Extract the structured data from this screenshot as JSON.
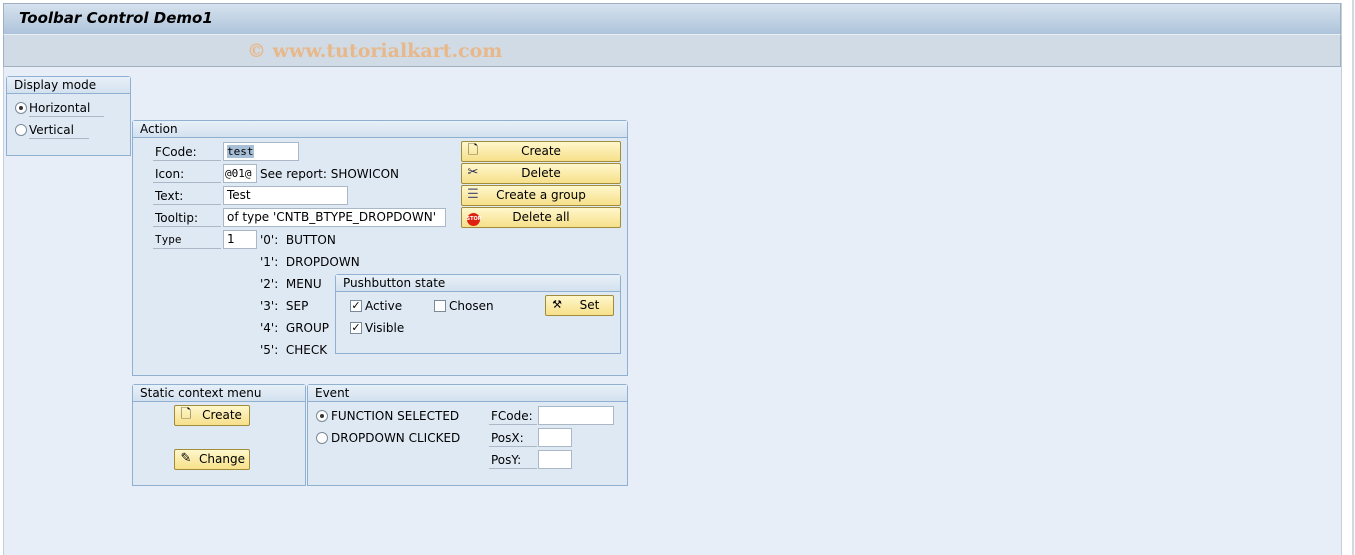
{
  "window": {
    "title": "Toolbar Control Demo1",
    "watermark": "© www.tutorialkart.com"
  },
  "display_mode": {
    "title": "Display mode",
    "options": [
      {
        "label": "Horizontal",
        "selected": true
      },
      {
        "label": "Vertical",
        "selected": false
      }
    ]
  },
  "action": {
    "title": "Action",
    "fcode_label": "FCode:",
    "fcode_value": "test",
    "icon_label": "Icon:",
    "icon_value": "@01@",
    "icon_hint": "See report: SHOWICON",
    "text_label": "Text:",
    "text_value": "Test",
    "tooltip_label": "Tooltip:",
    "tooltip_value": " of type 'CNTB_BTYPE_DROPDOWN'",
    "type_label": "Type",
    "type_value": "1",
    "type_options": [
      "'0':  BUTTON",
      "'1':  DROPDOWN",
      "'2':  MENU",
      "'3':  SEP",
      "'4':  GROUP",
      "'5':  CHECK"
    ],
    "buttons": [
      {
        "label": "Create",
        "icon": "document-icon"
      },
      {
        "label": "Delete",
        "icon": "scissors-icon"
      },
      {
        "label": "Create a group",
        "icon": "stack-icon"
      },
      {
        "label": "Delete all",
        "icon": "stop-icon"
      }
    ],
    "pushbutton_state": {
      "title": "Pushbutton state",
      "active_label": "Active",
      "active": true,
      "chosen_label": "Chosen",
      "chosen": false,
      "visible_label": "Visible",
      "visible": true,
      "set_label": "Set"
    }
  },
  "static_context_menu": {
    "title": "Static context menu",
    "create_label": "Create",
    "change_label": "Change"
  },
  "event": {
    "title": "Event",
    "options": [
      {
        "label": "FUNCTION SELECTED",
        "selected": true
      },
      {
        "label": "DROPDOWN CLICKED",
        "selected": false
      }
    ],
    "fcode_label": "FCode:",
    "fcode_value": "",
    "posx_label": "PosX:",
    "posx_value": "",
    "posy_label": "PosY:",
    "posy_value": ""
  }
}
